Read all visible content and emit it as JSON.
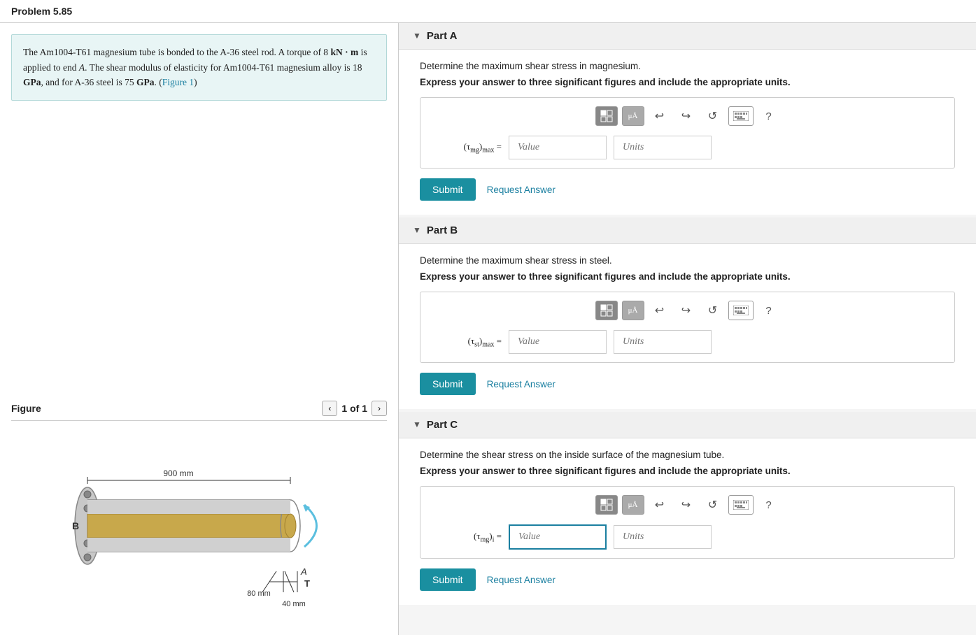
{
  "page": {
    "title": "Problem 5.85"
  },
  "problem": {
    "text_parts": [
      "The Am1004-T61 magnesium tube is bonded to the A-36 steel rod. A torque of 8 ",
      "kN·m",
      " is applied to end ",
      "A",
      ". The shear modulus of elasticity for Am1004-T61 magnesium alloy is 18 ",
      "GPa",
      ", and for A-36 steel is 75 ",
      "GPa",
      ". (",
      "Figure 1",
      ")"
    ],
    "figure_label": "Figure",
    "figure_nav": "1 of 1",
    "figure_dimensions": {
      "length_label": "900 mm",
      "bottom_label1": "80 mm",
      "bottom_label2": "40 mm",
      "point_B": "B",
      "point_A": "A",
      "point_T": "T"
    }
  },
  "parts": {
    "partA": {
      "label": "Part A",
      "description": "Determine the maximum shear stress in magnesium.",
      "instruction": "Express your answer to three significant figures and include the appropriate units.",
      "equation_label": "(τ_mg)_max =",
      "equation_label_display": "(τ",
      "equation_sub": "mg",
      "equation_end": ")_max =",
      "value_placeholder": "Value",
      "units_placeholder": "Units",
      "submit_label": "Submit",
      "request_label": "Request Answer"
    },
    "partB": {
      "label": "Part B",
      "description": "Determine the maximum shear stress in steel.",
      "instruction": "Express your answer to three significant figures and include the appropriate units.",
      "equation_label": "(τ_st)_max =",
      "value_placeholder": "Value",
      "units_placeholder": "Units",
      "submit_label": "Submit",
      "request_label": "Request Answer"
    },
    "partC": {
      "label": "Part C",
      "description": "Determine the shear stress on the inside surface of the magnesium tube.",
      "instruction": "Express your answer to three significant figures and include the appropriate units.",
      "equation_label": "(τ_mg)_i =",
      "value_placeholder": "Value",
      "units_placeholder": "Units",
      "submit_label": "Submit",
      "request_label": "Request Answer"
    }
  },
  "toolbar": {
    "grid_icon": "⊞",
    "mu_icon": "μÅ",
    "undo_icon": "↩",
    "redo_icon": "↪",
    "refresh_icon": "↺",
    "keyboard_icon": "⌨",
    "help_icon": "?"
  }
}
